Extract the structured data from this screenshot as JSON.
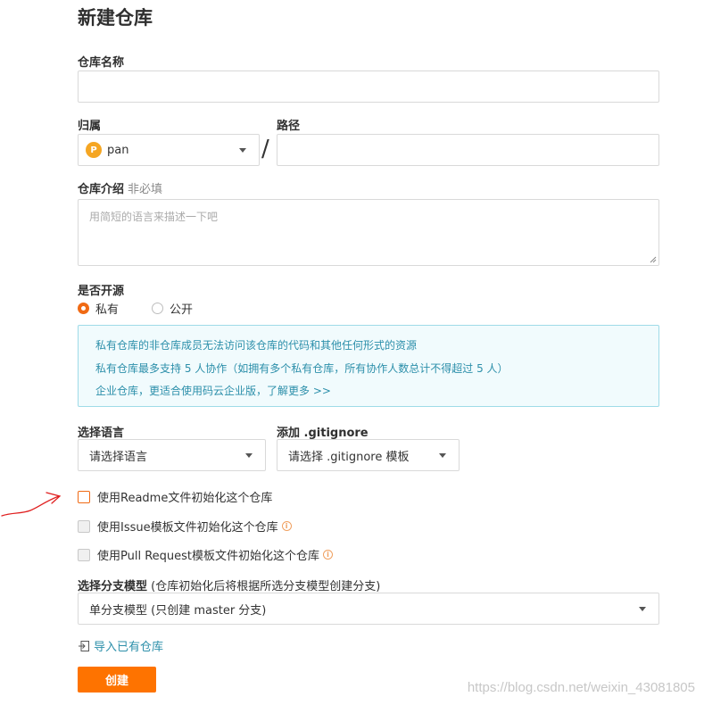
{
  "page": {
    "title": "新建仓库"
  },
  "form": {
    "repo_name_label": "仓库名称",
    "owner_label": "归属",
    "owner": {
      "avatar_letter": "P",
      "name": "pan"
    },
    "path_label": "路径",
    "slash": "/",
    "desc_label": "仓库介绍",
    "desc_optional": "非必填",
    "desc_placeholder": "用简短的语言来描述一下吧",
    "visibility_label": "是否开源",
    "visibility_options": [
      {
        "label": "私有",
        "selected": true
      },
      {
        "label": "公开",
        "selected": false
      }
    ],
    "info_lines": [
      "私有仓库的非仓库成员无法访问该仓库的代码和其他任何形式的资源",
      "私有仓库最多支持 5 人协作（如拥有多个私有仓库，所有协作人数总计不得超过 5 人）",
      "企业仓库，更适合使用码云企业版，"
    ],
    "info_link": "了解更多 >>",
    "language_label": "选择语言",
    "language_placeholder": "请选择语言",
    "gitignore_label": "添加 .gitignore",
    "gitignore_placeholder": "请选择 .gitignore 模板",
    "checkboxes": [
      {
        "label": "使用Readme文件初始化这个仓库",
        "checked": false
      },
      {
        "label": "使用Issue模板文件初始化这个仓库",
        "checked": false
      },
      {
        "label": "使用Pull Request模板文件初始化这个仓库",
        "checked": false
      }
    ],
    "branch_label": "选择分支模型",
    "branch_hint": "(仓库初始化后将根据所选分支模型创建分支)",
    "branch_value": "单分支模型 (只创建 master 分支)",
    "import_link": "导入已有仓库",
    "create_button": "创建"
  },
  "watermark": "https://blog.csdn.net/weixin_43081805",
  "colors": {
    "accent": "#fe7300",
    "info_text": "#2c8faa",
    "info_bg": "#f1fbfd",
    "annotation": "#e02020"
  }
}
